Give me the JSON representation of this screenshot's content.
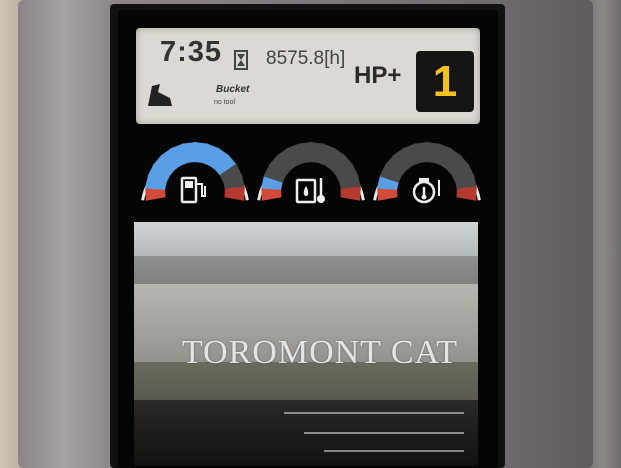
{
  "status_panel": {
    "time": "7:35",
    "hours": "8575.8[h]",
    "power_mode": "HP+",
    "gear": "1",
    "tool_name": "Bucket",
    "tool_subtitle": "no tool"
  },
  "gauges": [
    {
      "name": "fuel-level",
      "icon": "fuel-pump-icon",
      "level": 0.78,
      "accent": "#5a9ee6"
    },
    {
      "name": "hydraulic-oil-temp",
      "icon": "hydraulic-temp-icon",
      "level": 0.12,
      "accent": "#5a9ee6"
    },
    {
      "name": "engine-coolant-temp",
      "icon": "engine-temp-icon",
      "level": 0.12,
      "accent": "#5a9ee6"
    }
  ],
  "camera": {
    "view": "rear-camera-feed"
  },
  "watermark": "TOROMONT CAT",
  "colors": {
    "gear_bg": "#151515",
    "gear_text": "#f2c21a",
    "gauge_active": "#5a9ee6",
    "gauge_red": "#d24a3a",
    "panel_bg": "#dcd8d3"
  }
}
